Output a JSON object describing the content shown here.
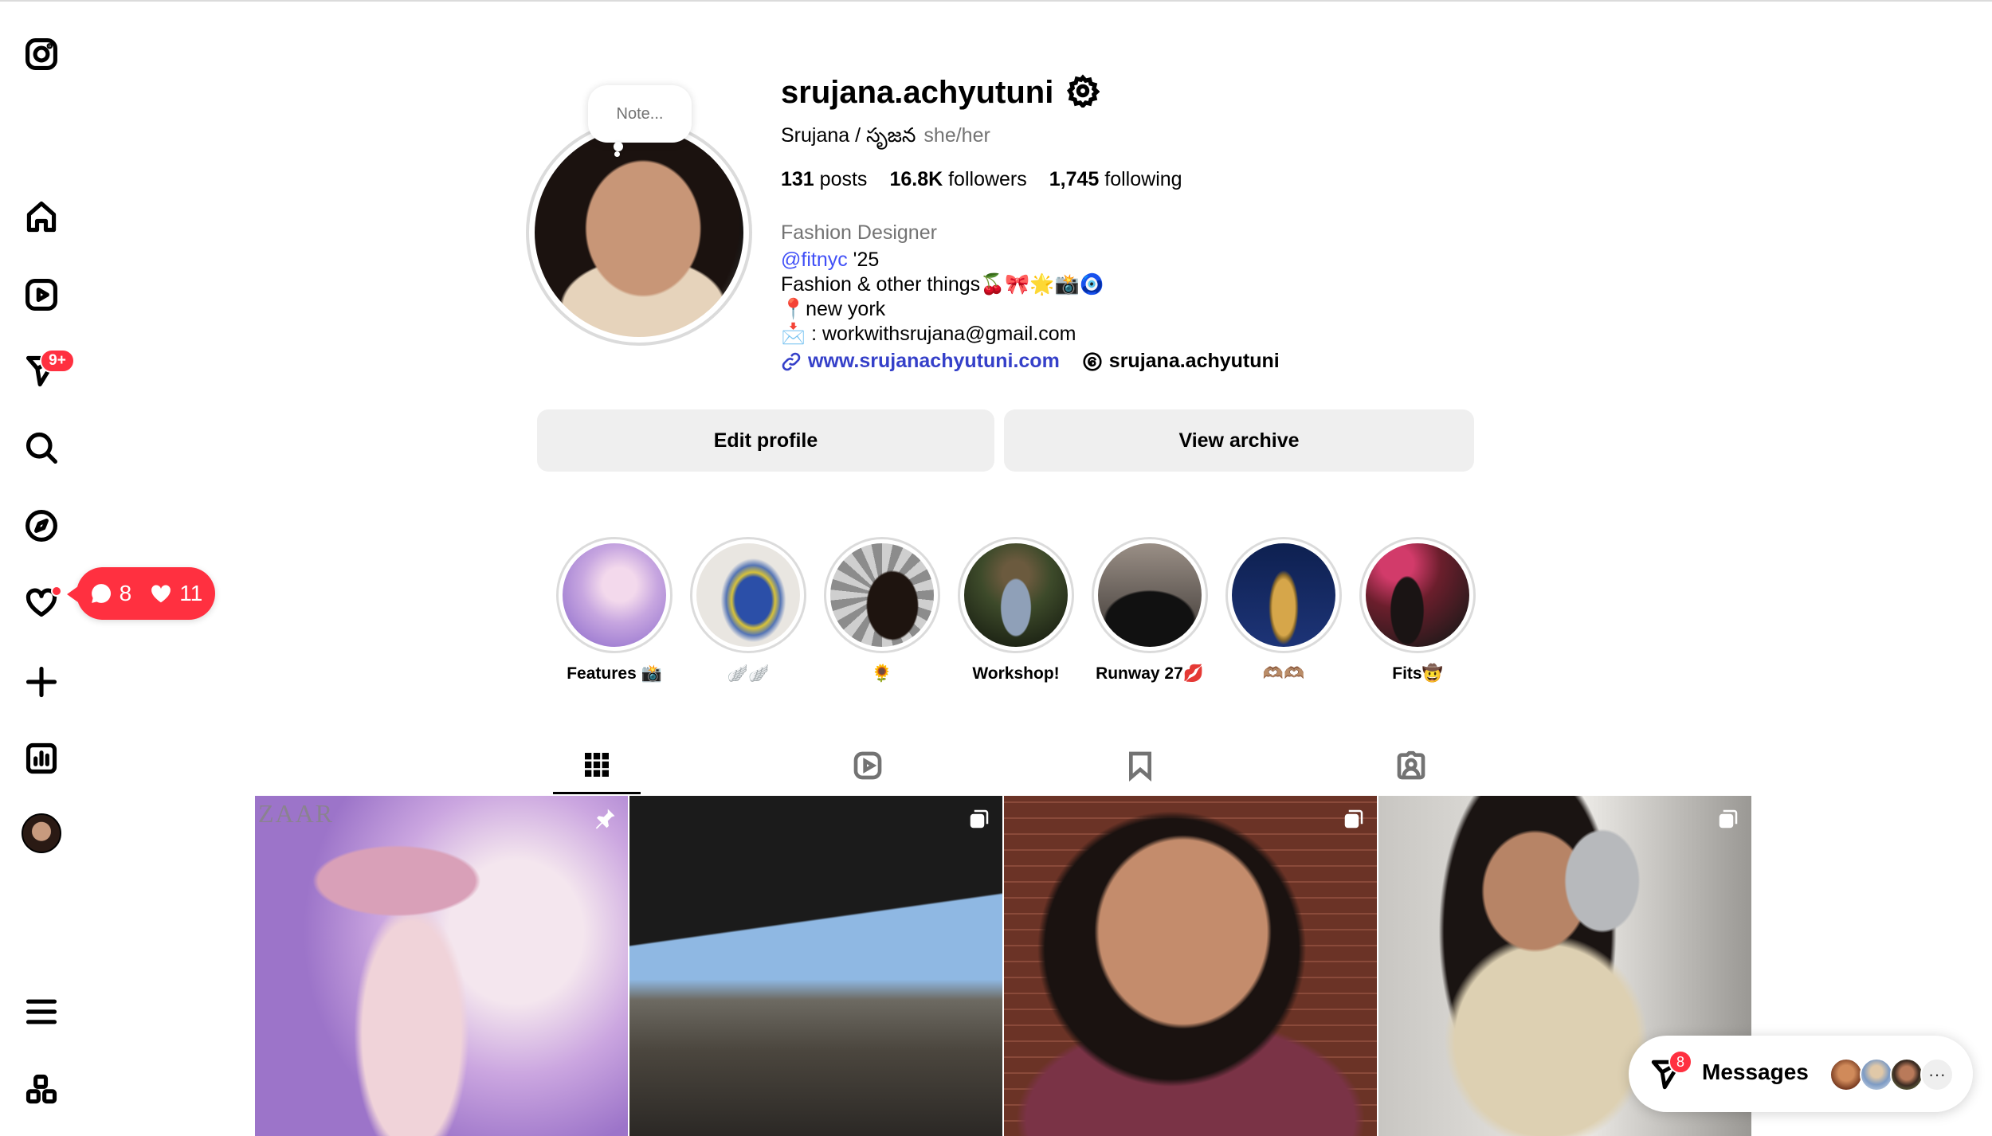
{
  "sidebar": {
    "items": [
      {
        "name": "instagram-logo-icon",
        "label": "Instagram"
      },
      {
        "name": "home-icon",
        "label": "Home"
      },
      {
        "name": "reels-icon",
        "label": "Reels"
      },
      {
        "name": "messages-icon",
        "label": "Messages"
      },
      {
        "name": "search-icon",
        "label": "Search"
      },
      {
        "name": "explore-icon",
        "label": "Explore"
      },
      {
        "name": "notifications-icon",
        "label": "Notifications"
      },
      {
        "name": "create-icon",
        "label": "Create"
      },
      {
        "name": "dashboard-icon",
        "label": "Dashboard"
      },
      {
        "name": "profile-avatar",
        "label": "Profile"
      },
      {
        "name": "menu-icon",
        "label": "More"
      },
      {
        "name": "apps-icon",
        "label": "Also from Meta"
      }
    ],
    "messages_badge": "9+",
    "notification_popup": {
      "comments": "8",
      "likes": "11"
    }
  },
  "profile": {
    "note_placeholder": "Note...",
    "username": "srujana.achyutuni",
    "full_name": "Srujana / సృజన",
    "pronouns": "she/her",
    "stats": {
      "posts_count": "131",
      "posts_label": "posts",
      "followers_count": "16.8K",
      "followers_label": "followers",
      "following_count": "1,745",
      "following_label": "following"
    },
    "category": "Fashion Designer",
    "bio": {
      "mention": "@fitnyc",
      "mention_suffix": " '25",
      "line2": "Fashion & other things🍒🎀🌟📸🧿",
      "line3": "📍new york",
      "line4": "📩 : workwithsrujana@gmail.com"
    },
    "website": "www.srujanachyutuni.com",
    "threads_handle": "srujana.achyutuni"
  },
  "actions": {
    "edit_profile": "Edit profile",
    "view_archive": "View archive"
  },
  "highlights": [
    {
      "label": "Features 📸"
    },
    {
      "label": "🪽🪽"
    },
    {
      "label": "🌻"
    },
    {
      "label": "Workshop!"
    },
    {
      "label": "Runway 27💋"
    },
    {
      "label": "🫶🏽🫶🏽"
    },
    {
      "label": "Fits🤠"
    }
  ],
  "tabs": [
    {
      "name": "tab-posts",
      "icon": "grid-icon",
      "active": true
    },
    {
      "name": "tab-reels",
      "icon": "reels-icon",
      "active": false
    },
    {
      "name": "tab-saved",
      "icon": "bookmark-icon",
      "active": false
    },
    {
      "name": "tab-tagged",
      "icon": "tagged-icon",
      "active": false
    }
  ],
  "posts": [
    {
      "type": "pinned",
      "overlay_text": "ZAAR"
    },
    {
      "type": "carousel"
    },
    {
      "type": "carousel"
    },
    {
      "type": "carousel"
    }
  ],
  "messages_bar": {
    "label": "Messages",
    "badge": "8",
    "more": "···"
  },
  "colors": {
    "accent_red": "#ff3040",
    "link_blue": "#3540c9",
    "mention_blue": "#4150f7",
    "button_gray": "#efefef",
    "muted_text": "#737373"
  }
}
